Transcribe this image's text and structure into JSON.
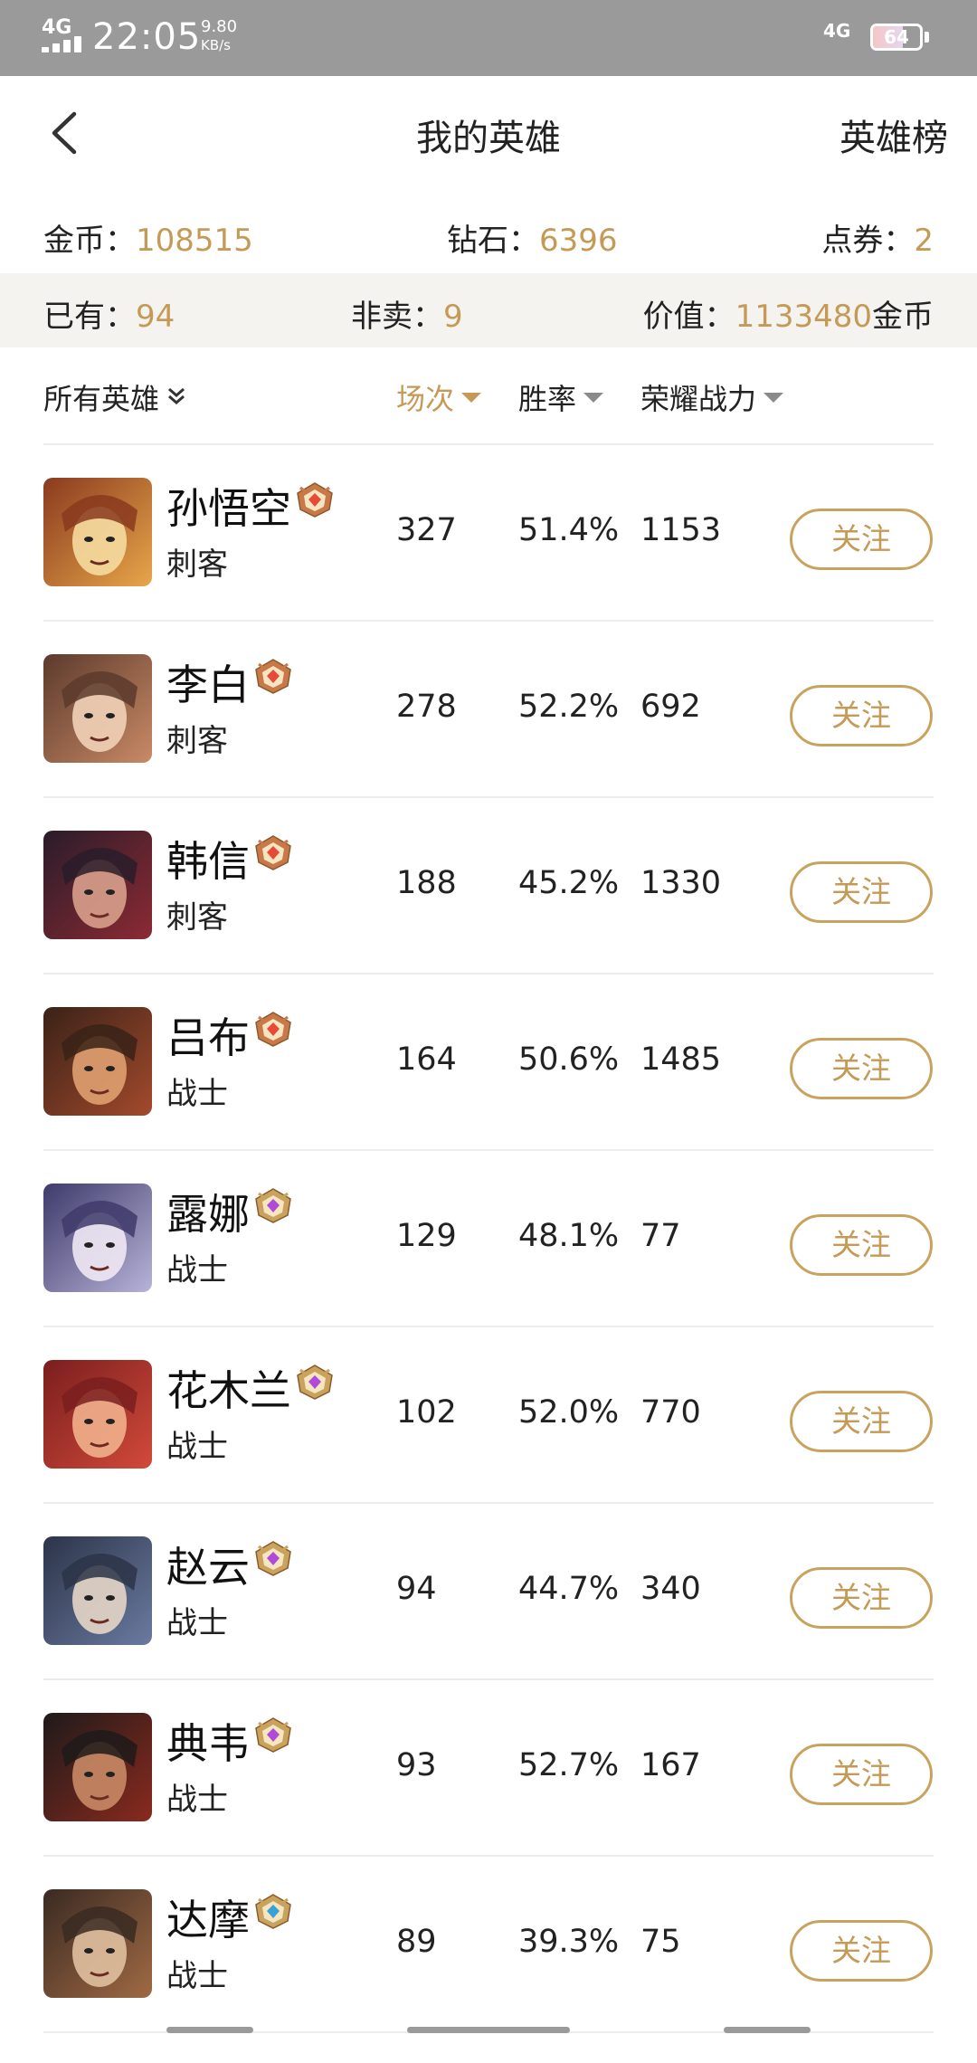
{
  "status_bar": {
    "network_left": "4G",
    "time": "22:05",
    "speed_value": "9.80",
    "speed_unit": "KB/s",
    "network_right": "4G",
    "battery": "64",
    "battery_level": 0.64
  },
  "header": {
    "title": "我的英雄",
    "right_link": "英雄榜"
  },
  "currency": {
    "gold_label": "金币：",
    "gold_value": "108515",
    "diamond_label": "钻石：",
    "diamond_value": "6396",
    "voucher_label": "点券：",
    "voucher_value": "2"
  },
  "stats": {
    "owned_label": "已有：",
    "owned_value": "94",
    "not_for_sale_label": "非卖：",
    "not_for_sale_value": "9",
    "worth_label": "价值：",
    "worth_value": "1133480",
    "worth_unit": "金币"
  },
  "columns": {
    "filter_label": "所有英雄",
    "matches": "场次",
    "win_rate": "胜率",
    "power": "荣耀战力"
  },
  "colors": {
    "accent_gold": "#c49a56",
    "band_bg": "#f5f3ef",
    "status_bar_bg": "#9a9a9a"
  },
  "heroes": [
    {
      "name": "孙悟空",
      "role": "刺客",
      "matches": "327",
      "win_rate": "51.4%",
      "power": "1153",
      "button": "关注",
      "mastery_icon": "mastery-emblem-red-icon"
    },
    {
      "name": "李白",
      "role": "刺客",
      "matches": "278",
      "win_rate": "52.2%",
      "power": "692",
      "button": "关注",
      "mastery_icon": "mastery-emblem-red-icon"
    },
    {
      "name": "韩信",
      "role": "刺客",
      "matches": "188",
      "win_rate": "45.2%",
      "power": "1330",
      "button": "关注",
      "mastery_icon": "mastery-emblem-red-icon"
    },
    {
      "name": "吕布",
      "role": "战士",
      "matches": "164",
      "win_rate": "50.6%",
      "power": "1485",
      "button": "关注",
      "mastery_icon": "mastery-emblem-red-icon"
    },
    {
      "name": "露娜",
      "role": "战士",
      "matches": "129",
      "win_rate": "48.1%",
      "power": "77",
      "button": "关注",
      "mastery_icon": "mastery-emblem-purple-icon"
    },
    {
      "name": "花木兰",
      "role": "战士",
      "matches": "102",
      "win_rate": "52.0%",
      "power": "770",
      "button": "关注",
      "mastery_icon": "mastery-emblem-purple-icon"
    },
    {
      "name": "赵云",
      "role": "战士",
      "matches": "94",
      "win_rate": "44.7%",
      "power": "340",
      "button": "关注",
      "mastery_icon": "mastery-emblem-purple-icon"
    },
    {
      "name": "典韦",
      "role": "战士",
      "matches": "93",
      "win_rate": "52.7%",
      "power": "167",
      "button": "关注",
      "mastery_icon": "mastery-emblem-purple-icon"
    },
    {
      "name": "达摩",
      "role": "战士",
      "matches": "89",
      "win_rate": "39.3%",
      "power": "75",
      "button": "关注",
      "mastery_icon": "mastery-emblem-blue-icon"
    }
  ]
}
